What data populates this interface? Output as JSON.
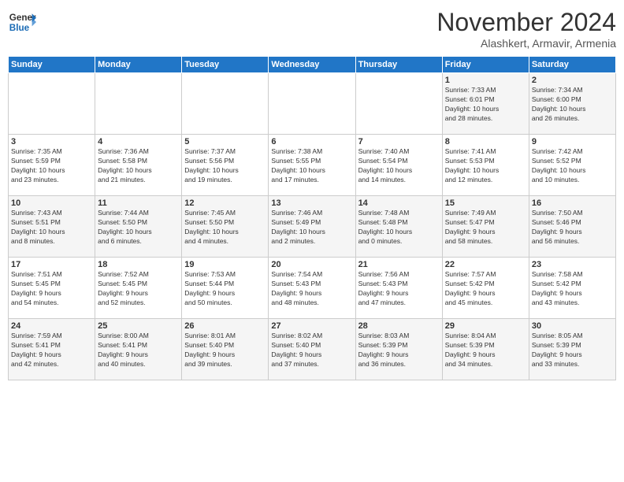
{
  "header": {
    "logo_line1": "General",
    "logo_line2": "Blue",
    "month": "November 2024",
    "location": "Alashkert, Armavir, Armenia"
  },
  "days_of_week": [
    "Sunday",
    "Monday",
    "Tuesday",
    "Wednesday",
    "Thursday",
    "Friday",
    "Saturday"
  ],
  "weeks": [
    [
      {
        "day": "",
        "info": ""
      },
      {
        "day": "",
        "info": ""
      },
      {
        "day": "",
        "info": ""
      },
      {
        "day": "",
        "info": ""
      },
      {
        "day": "",
        "info": ""
      },
      {
        "day": "1",
        "info": "Sunrise: 7:33 AM\nSunset: 6:01 PM\nDaylight: 10 hours\nand 28 minutes."
      },
      {
        "day": "2",
        "info": "Sunrise: 7:34 AM\nSunset: 6:00 PM\nDaylight: 10 hours\nand 26 minutes."
      }
    ],
    [
      {
        "day": "3",
        "info": "Sunrise: 7:35 AM\nSunset: 5:59 PM\nDaylight: 10 hours\nand 23 minutes."
      },
      {
        "day": "4",
        "info": "Sunrise: 7:36 AM\nSunset: 5:58 PM\nDaylight: 10 hours\nand 21 minutes."
      },
      {
        "day": "5",
        "info": "Sunrise: 7:37 AM\nSunset: 5:56 PM\nDaylight: 10 hours\nand 19 minutes."
      },
      {
        "day": "6",
        "info": "Sunrise: 7:38 AM\nSunset: 5:55 PM\nDaylight: 10 hours\nand 17 minutes."
      },
      {
        "day": "7",
        "info": "Sunrise: 7:40 AM\nSunset: 5:54 PM\nDaylight: 10 hours\nand 14 minutes."
      },
      {
        "day": "8",
        "info": "Sunrise: 7:41 AM\nSunset: 5:53 PM\nDaylight: 10 hours\nand 12 minutes."
      },
      {
        "day": "9",
        "info": "Sunrise: 7:42 AM\nSunset: 5:52 PM\nDaylight: 10 hours\nand 10 minutes."
      }
    ],
    [
      {
        "day": "10",
        "info": "Sunrise: 7:43 AM\nSunset: 5:51 PM\nDaylight: 10 hours\nand 8 minutes."
      },
      {
        "day": "11",
        "info": "Sunrise: 7:44 AM\nSunset: 5:50 PM\nDaylight: 10 hours\nand 6 minutes."
      },
      {
        "day": "12",
        "info": "Sunrise: 7:45 AM\nSunset: 5:50 PM\nDaylight: 10 hours\nand 4 minutes."
      },
      {
        "day": "13",
        "info": "Sunrise: 7:46 AM\nSunset: 5:49 PM\nDaylight: 10 hours\nand 2 minutes."
      },
      {
        "day": "14",
        "info": "Sunrise: 7:48 AM\nSunset: 5:48 PM\nDaylight: 10 hours\nand 0 minutes."
      },
      {
        "day": "15",
        "info": "Sunrise: 7:49 AM\nSunset: 5:47 PM\nDaylight: 9 hours\nand 58 minutes."
      },
      {
        "day": "16",
        "info": "Sunrise: 7:50 AM\nSunset: 5:46 PM\nDaylight: 9 hours\nand 56 minutes."
      }
    ],
    [
      {
        "day": "17",
        "info": "Sunrise: 7:51 AM\nSunset: 5:45 PM\nDaylight: 9 hours\nand 54 minutes."
      },
      {
        "day": "18",
        "info": "Sunrise: 7:52 AM\nSunset: 5:45 PM\nDaylight: 9 hours\nand 52 minutes."
      },
      {
        "day": "19",
        "info": "Sunrise: 7:53 AM\nSunset: 5:44 PM\nDaylight: 9 hours\nand 50 minutes."
      },
      {
        "day": "20",
        "info": "Sunrise: 7:54 AM\nSunset: 5:43 PM\nDaylight: 9 hours\nand 48 minutes."
      },
      {
        "day": "21",
        "info": "Sunrise: 7:56 AM\nSunset: 5:43 PM\nDaylight: 9 hours\nand 47 minutes."
      },
      {
        "day": "22",
        "info": "Sunrise: 7:57 AM\nSunset: 5:42 PM\nDaylight: 9 hours\nand 45 minutes."
      },
      {
        "day": "23",
        "info": "Sunrise: 7:58 AM\nSunset: 5:42 PM\nDaylight: 9 hours\nand 43 minutes."
      }
    ],
    [
      {
        "day": "24",
        "info": "Sunrise: 7:59 AM\nSunset: 5:41 PM\nDaylight: 9 hours\nand 42 minutes."
      },
      {
        "day": "25",
        "info": "Sunrise: 8:00 AM\nSunset: 5:41 PM\nDaylight: 9 hours\nand 40 minutes."
      },
      {
        "day": "26",
        "info": "Sunrise: 8:01 AM\nSunset: 5:40 PM\nDaylight: 9 hours\nand 39 minutes."
      },
      {
        "day": "27",
        "info": "Sunrise: 8:02 AM\nSunset: 5:40 PM\nDaylight: 9 hours\nand 37 minutes."
      },
      {
        "day": "28",
        "info": "Sunrise: 8:03 AM\nSunset: 5:39 PM\nDaylight: 9 hours\nand 36 minutes."
      },
      {
        "day": "29",
        "info": "Sunrise: 8:04 AM\nSunset: 5:39 PM\nDaylight: 9 hours\nand 34 minutes."
      },
      {
        "day": "30",
        "info": "Sunrise: 8:05 AM\nSunset: 5:39 PM\nDaylight: 9 hours\nand 33 minutes."
      }
    ]
  ]
}
